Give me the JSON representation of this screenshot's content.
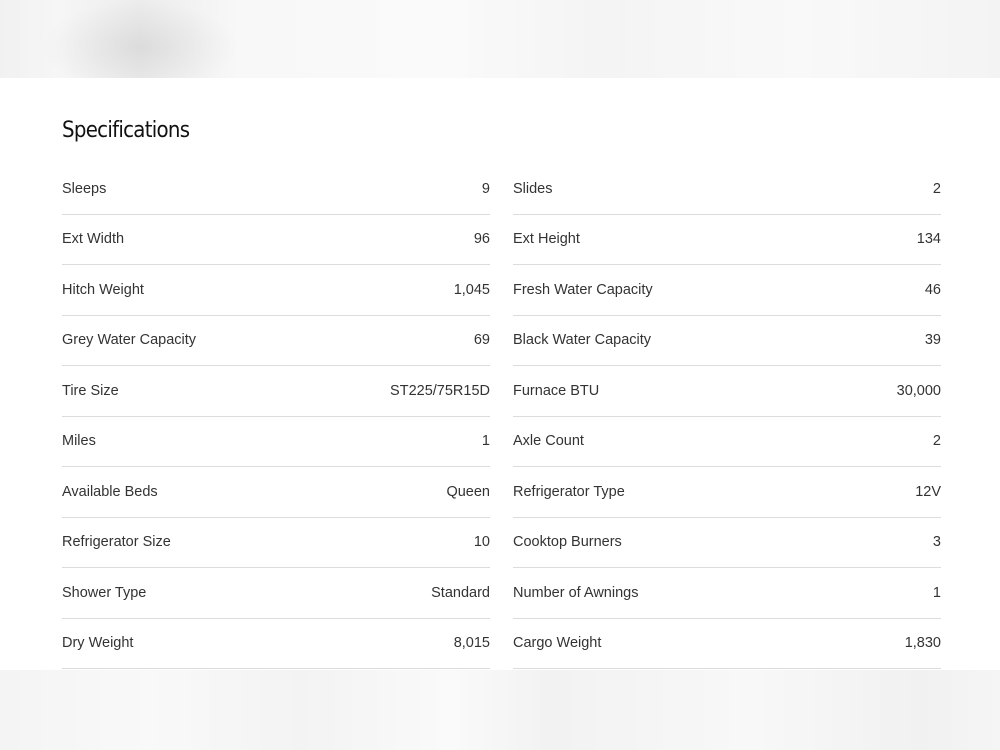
{
  "heading": "Specifications",
  "specs_left": [
    {
      "label": "Sleeps",
      "value": "9"
    },
    {
      "label": "Ext Width",
      "value": "96"
    },
    {
      "label": "Hitch Weight",
      "value": "1,045"
    },
    {
      "label": "Grey Water Capacity",
      "value": "69"
    },
    {
      "label": "Tire Size",
      "value": "ST225/75R15D"
    },
    {
      "label": "Miles",
      "value": "1"
    },
    {
      "label": "Available Beds",
      "value": "Queen"
    },
    {
      "label": "Refrigerator Size",
      "value": "10"
    },
    {
      "label": "Shower Type",
      "value": "Standard"
    },
    {
      "label": "Dry Weight",
      "value": "8,015"
    }
  ],
  "specs_right": [
    {
      "label": "Slides",
      "value": "2"
    },
    {
      "label": "Ext Height",
      "value": "134"
    },
    {
      "label": "Fresh Water Capacity",
      "value": "46"
    },
    {
      "label": "Black Water Capacity",
      "value": "39"
    },
    {
      "label": "Furnace BTU",
      "value": "30,000"
    },
    {
      "label": "Axle Count",
      "value": "2"
    },
    {
      "label": "Refrigerator Type",
      "value": "12V"
    },
    {
      "label": "Cooktop Burners",
      "value": "3"
    },
    {
      "label": "Number of Awnings",
      "value": "1"
    },
    {
      "label": "Cargo Weight",
      "value": "1,830"
    }
  ]
}
